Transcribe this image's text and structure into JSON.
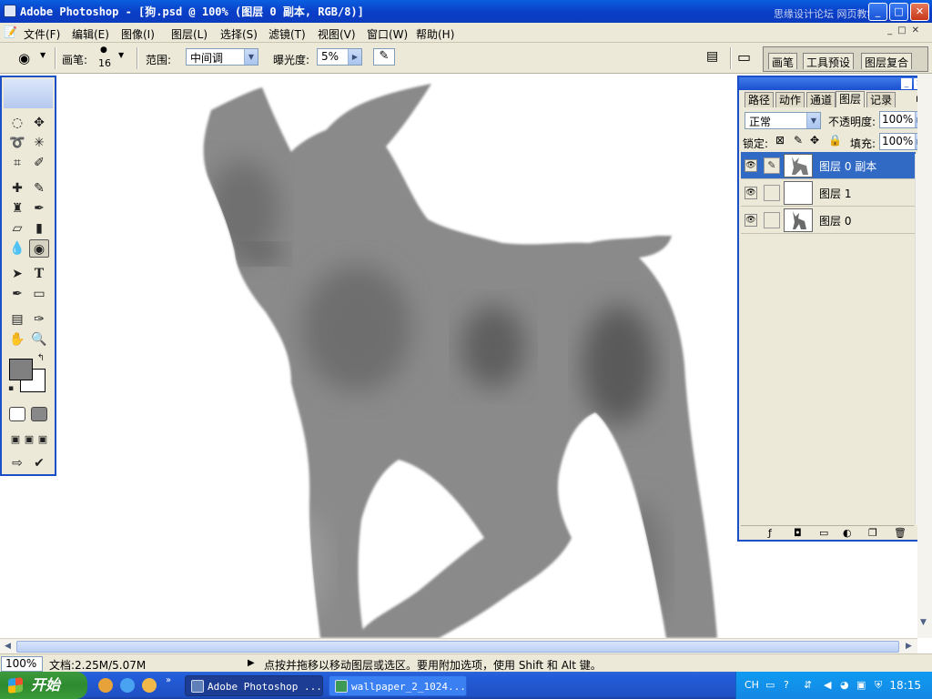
{
  "titlebar": {
    "title": "Adobe Photoshop - [狗.psd @ 100% (图层 0 副本, RGB/8)]",
    "watermark": "思缘设计论坛   网页教学网"
  },
  "menu": [
    "文件(F)",
    "编辑(E)",
    "图像(I)",
    "图层(L)",
    "选择(S)",
    "滤镜(T)",
    "视图(V)",
    "窗口(W)",
    "帮助(H)"
  ],
  "options": {
    "brush_label": "画笔:",
    "brush_size": "16",
    "range_label": "范围:",
    "range_value": "中间调",
    "exposure_label": "曝光度:",
    "exposure_value": "5%"
  },
  "palette_well_tabs": [
    "画笔",
    "工具预设",
    "图层复合"
  ],
  "layers_panel": {
    "tabs": [
      "路径",
      "动作",
      "通道",
      "图层",
      "记录"
    ],
    "active_tab": "图层",
    "blend_mode": "正常",
    "opacity_label": "不透明度:",
    "opacity_value": "100%",
    "lock_label": "锁定:",
    "fill_label": "填充:",
    "fill_value": "100%",
    "layers": [
      {
        "name": "图层 0 副本",
        "selected": true
      },
      {
        "name": "图层 1",
        "selected": false
      },
      {
        "name": "图层 0",
        "selected": false
      }
    ]
  },
  "status": {
    "zoom": "100%",
    "doc_info": "文档:2.25M/5.07M",
    "hint": "点按并拖移以移动图层或选区。要用附加选项，使用 Shift 和 Alt 键。"
  },
  "taskbar": {
    "start_label": "开始",
    "tasks": [
      "Adobe Photoshop ...",
      "wallpaper_2_1024..."
    ],
    "tray_lang": "CH",
    "clock": "18:15"
  },
  "colors": {
    "xp_blue": "#0a3fc8",
    "selection": "#316ac5",
    "dog_gray": "#808080"
  }
}
